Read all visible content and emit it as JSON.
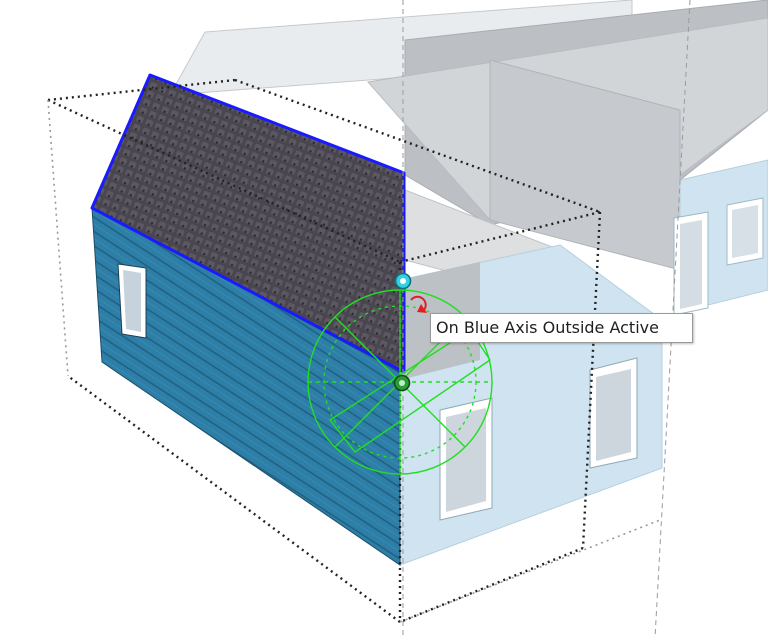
{
  "tooltip": {
    "text": "On Blue Axis Outside Active"
  },
  "colors": {
    "roof_selection": "#1a1aff",
    "protractor": "#22dd22",
    "rotate_handle": "#e02020",
    "siding": "#2e7fa8",
    "house_wall": "#cfe4f0",
    "ghost_geometry": "#c8cbcf"
  },
  "icons": {
    "rotation_handle": "rotate-arrows-icon",
    "protractor": "protractor-icon",
    "inference_start": "cyan-endpoint-icon",
    "inference_end": "green-endpoint-icon"
  }
}
